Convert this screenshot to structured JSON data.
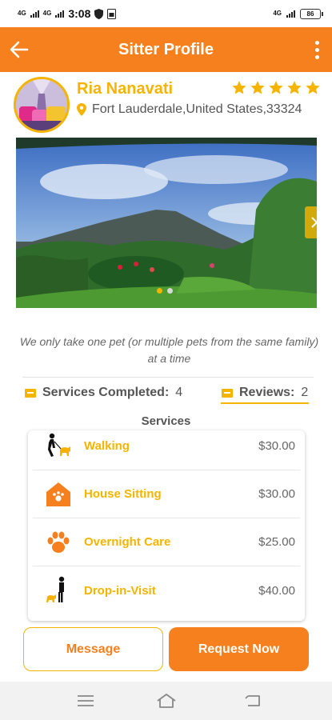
{
  "status_bar": {
    "time": "3:08",
    "signal_1": "4G",
    "signal_2": "4G",
    "right_signal": "4G",
    "battery": "86"
  },
  "app_bar": {
    "title": "Sitter Profile",
    "back_icon": "arrow-left-icon",
    "menu_icon": "more-vertical-icon"
  },
  "profile": {
    "name": "Ria Nanavati",
    "rating": 5,
    "rating_max": 5,
    "location": "Fort Lauderdale,United States,33324"
  },
  "gallery": {
    "slide_count": 2,
    "active_slide": 1
  },
  "bio": "We only take one pet (or multiple pets from the same family) at a time",
  "stats": {
    "services_completed_label": "Services Completed:",
    "services_completed_value": "4",
    "reviews_label": "Reviews:",
    "reviews_value": "2"
  },
  "services_heading": "Services",
  "services": [
    {
      "name": "Walking",
      "price": "$30.00",
      "icon": "dog-walking-icon"
    },
    {
      "name": "House Sitting",
      "price": "$30.00",
      "icon": "pet-house-icon"
    },
    {
      "name": "Overnight Care",
      "price": "$25.00",
      "icon": "paw-icon"
    },
    {
      "name": "Drop-in-Visit",
      "price": "$40.00",
      "icon": "person-with-dog-icon"
    }
  ],
  "actions": {
    "message_label": "Message",
    "request_label": "Request Now"
  },
  "colors": {
    "primary": "#f7801e",
    "accent": "#f4b400",
    "text": "#555555"
  }
}
